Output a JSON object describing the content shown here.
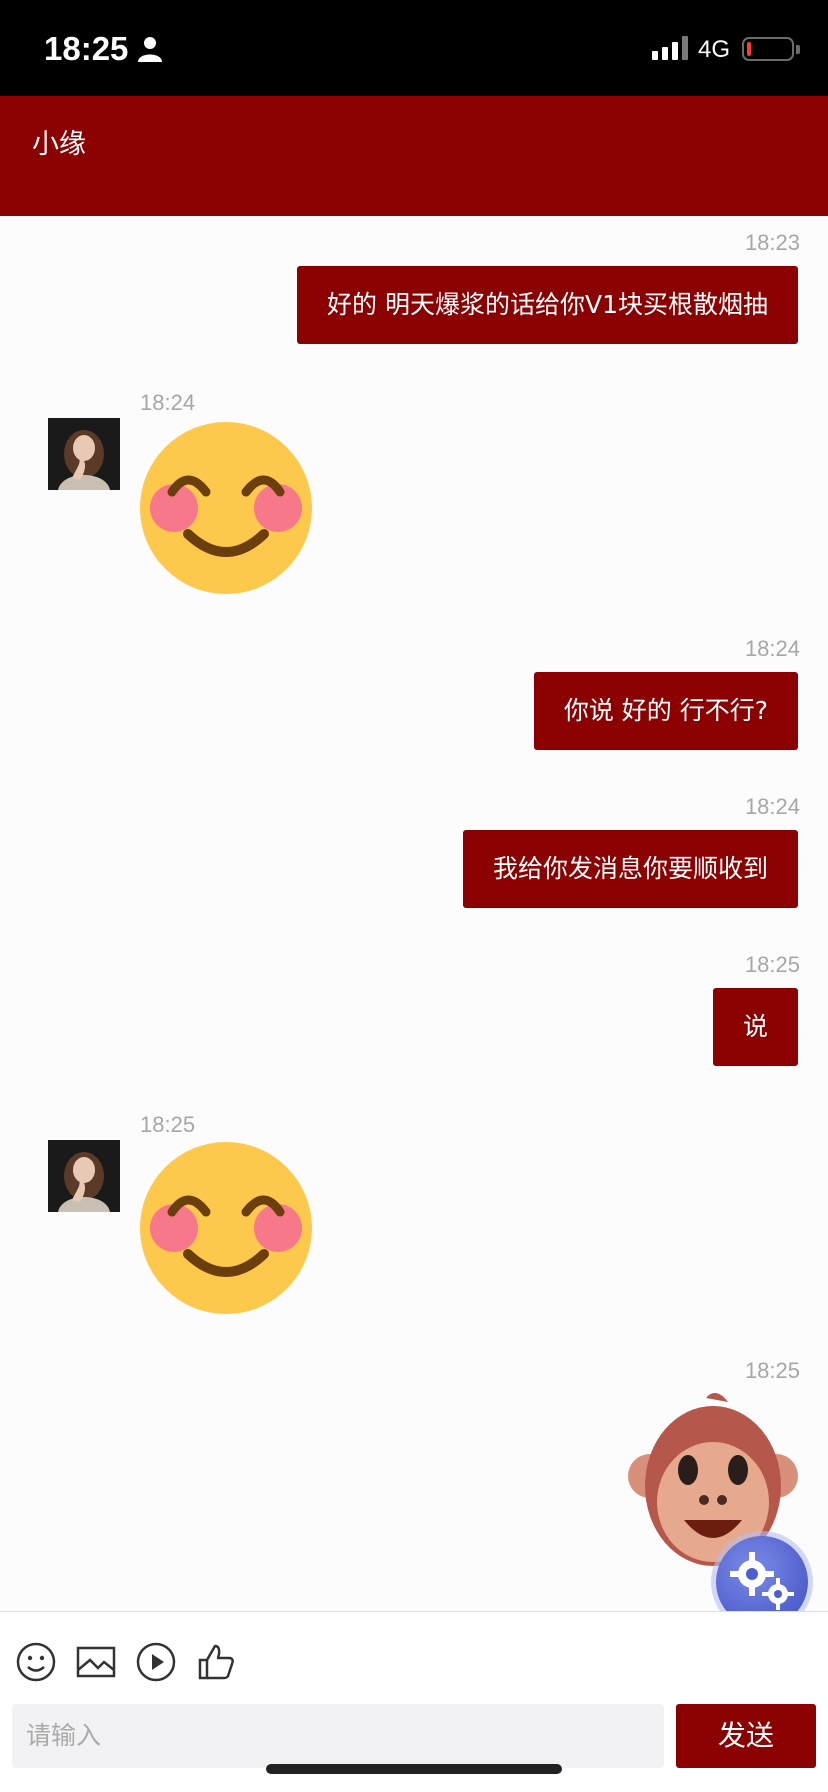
{
  "status_bar": {
    "time": "18:25",
    "network": "4G",
    "battery_level": 0.1,
    "icons": [
      "person-icon",
      "signal-bars-icon",
      "battery-icon"
    ]
  },
  "header": {
    "title": "小缘"
  },
  "messages": [
    {
      "time": "18:23",
      "side": "right",
      "type": "text",
      "text": "好的 明天爆浆的话给你V1块买根散烟抽"
    },
    {
      "time": "18:24",
      "side": "left",
      "type": "sticker",
      "sticker": "smiling-blush-emoji"
    },
    {
      "time": "18:24",
      "side": "right",
      "type": "text",
      "text": "你说 好的 行不行?"
    },
    {
      "time": "18:24",
      "side": "right",
      "type": "text",
      "text": "我给你发消息你要顺收到"
    },
    {
      "time": "18:25",
      "side": "right",
      "type": "text",
      "text": "说"
    },
    {
      "time": "18:25",
      "side": "left",
      "type": "sticker",
      "sticker": "smiling-blush-emoji"
    },
    {
      "time": "18:25",
      "side": "right",
      "type": "sticker",
      "sticker": "monkey-face-emoji"
    }
  ],
  "toolbar": {
    "icons": [
      "emoji-icon",
      "image-icon",
      "video-icon",
      "thumbs-up-icon"
    ],
    "input_placeholder": "请输入",
    "send_label": "发送"
  },
  "colors": {
    "accent": "#8b0000",
    "timestamp": "#a7a7a7",
    "emoji_face": "#fcc94c",
    "blush": "#f7788b"
  }
}
